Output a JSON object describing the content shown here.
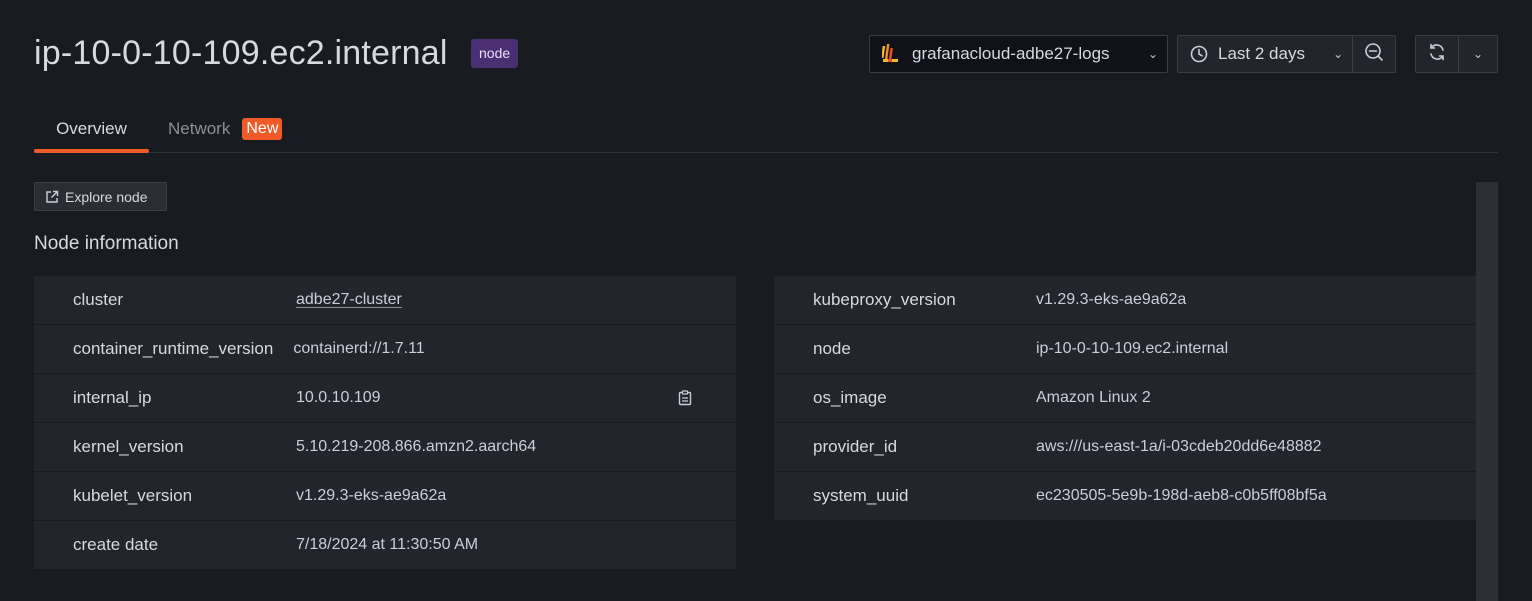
{
  "header": {
    "title": "ip-10-0-10-109.ec2.internal",
    "badge": "node",
    "datasource": "grafanacloud-adbe27-logs",
    "time_range": "Last 2 days"
  },
  "tabs": [
    {
      "label": "Overview",
      "active": true
    },
    {
      "label": "Network",
      "badge": "New"
    }
  ],
  "explore_button": "Explore node",
  "section_title": "Node information",
  "left_rows": [
    {
      "key": "cluster",
      "value": "adbe27-cluster"
    },
    {
      "key": "container_runtime_version",
      "value": "containerd://1.7.11"
    },
    {
      "key": "internal_ip",
      "value": "10.0.10.109"
    },
    {
      "key": "kernel_version",
      "value": "5.10.219-208.866.amzn2.aarch64"
    },
    {
      "key": "kubelet_version",
      "value": "v1.29.3-eks-ae9a62a"
    },
    {
      "key": "create date",
      "value": "7/18/2024 at 11:30:50 AM"
    }
  ],
  "right_rows": [
    {
      "key": "kubeproxy_version",
      "value": "v1.29.3-eks-ae9a62a"
    },
    {
      "key": "node",
      "value": "ip-10-0-10-109.ec2.internal"
    },
    {
      "key": "os_image",
      "value": "Amazon Linux 2"
    },
    {
      "key": "provider_id",
      "value": "aws:///us-east-1a/i-03cdeb20dd6e48882"
    },
    {
      "key": "system_uuid",
      "value": "ec230505-5e9b-198d-aeb8-c0b5ff08bf5a"
    }
  ],
  "colors": {
    "background": "#181b1f",
    "panel": "#22252b",
    "accent": "#f05a28",
    "node_badge": "#4b2f73"
  }
}
